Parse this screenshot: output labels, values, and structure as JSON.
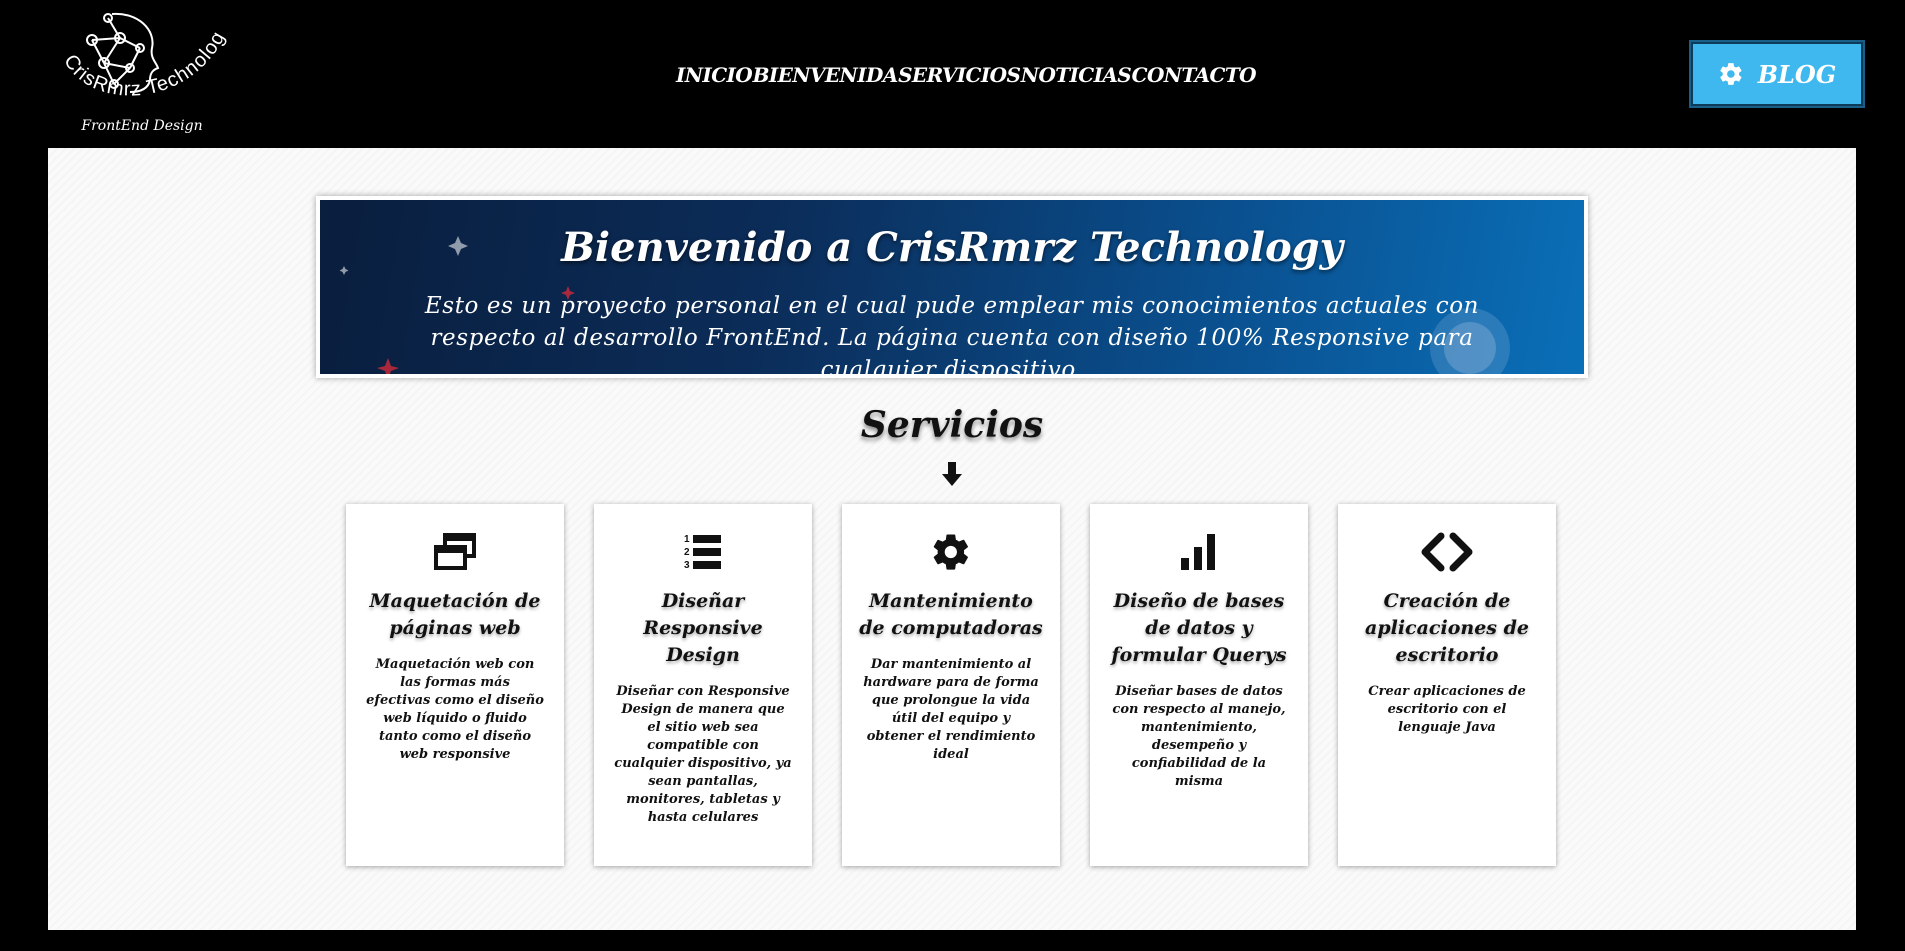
{
  "header": {
    "logo": {
      "name": "CrisRmrz Technology",
      "tagline": "FrontEnd Design"
    },
    "nav": [
      {
        "label": "INICIO"
      },
      {
        "label": "BIENVENIDA"
      },
      {
        "label": "SERVICIOS"
      },
      {
        "label": "NOTICIAS"
      },
      {
        "label": "CONTACTO"
      }
    ],
    "blog_button": {
      "label": "BLOG",
      "icon": "gear-icon"
    }
  },
  "hero": {
    "title": "Bienvenido a CrisRmrz Technology",
    "text": "Esto es un proyecto personal en el cual pude emplear mis conocimientos actuales con respecto al desarrollo FrontEnd. La página cuenta con diseño 100% Responsive para cualquier dispositivo."
  },
  "services": {
    "title": "Servicios",
    "arrow_icon": "arrow-down-icon",
    "cards": [
      {
        "icon": "windows-icon",
        "title": "Maquetación de páginas web",
        "text": "Maquetación web con las formas más efectivas como el diseño web líquido o fluido tanto como el diseño web responsive"
      },
      {
        "icon": "numbered-list-icon",
        "title": "Diseñar Responsive Design",
        "text": "Diseñar con Responsive Design de manera que el sitio web sea compatible con cualquier dispositivo, ya sean pantallas, monitores, tabletas y hasta celulares"
      },
      {
        "icon": "gear-icon",
        "title": "Mantenimiento de computadoras",
        "text": "Dar mantenimiento al hardware para de forma que prolongue la vida útil del equipo y obtener el rendimiento ideal"
      },
      {
        "icon": "bar-chart-icon",
        "title": "Diseño de bases de datos y formular Querys",
        "text": "Diseñar bases de datos con respecto al manejo, mantenimiento, desempeño y confiabilidad de la misma"
      },
      {
        "icon": "code-icon",
        "title": "Creación de aplicaciones de escritorio",
        "text": "Crear aplicaciones de escritorio con el lenguaje Java"
      }
    ]
  },
  "colors": {
    "header_bg": "#000000",
    "blog_button": "#3eb8ef",
    "hero_gradient_start": "#0a1e3e",
    "hero_gradient_end": "#0a6fb8"
  }
}
